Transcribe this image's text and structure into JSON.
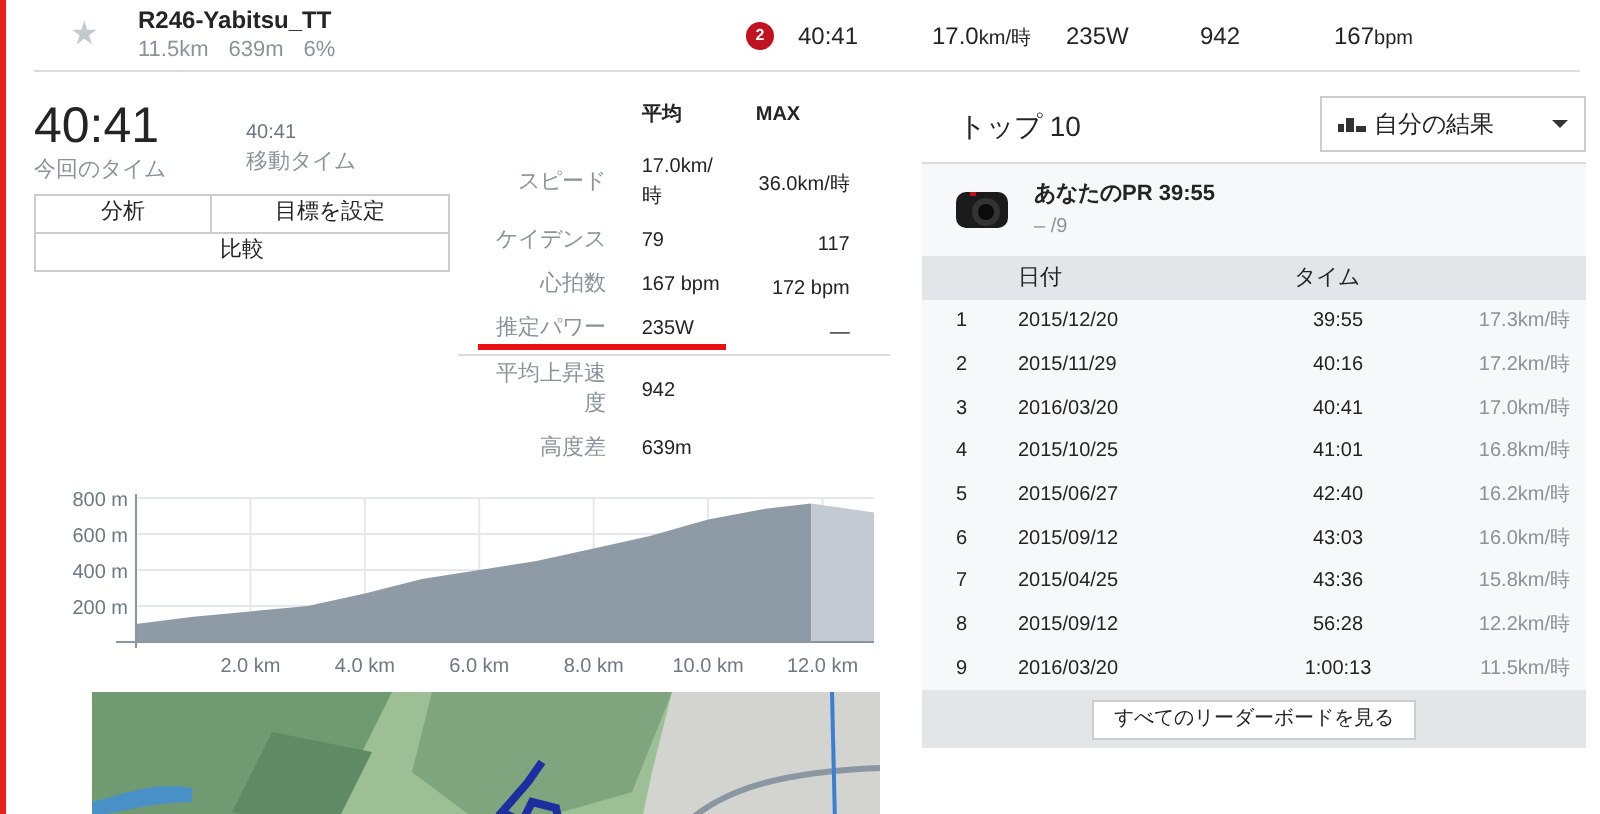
{
  "segment_row": {
    "star_icon": "★",
    "starred": false,
    "title": "R246-Yabitsu_TT",
    "stats": [
      "11.5km",
      "639m",
      "6%"
    ],
    "badge": "2",
    "time": "40:41",
    "speed": {
      "value": "17.0",
      "unit": "km/時"
    },
    "power": "235W",
    "climb": "942",
    "heart": {
      "value": "167",
      "unit": "bpm"
    }
  },
  "summary": {
    "time": "40:41",
    "time_label": "今回のタイム",
    "moving_time": "40:41",
    "moving_label": "移動タイム"
  },
  "buttons": [
    {
      "label": "分析"
    },
    {
      "label": "目標を設定"
    },
    {
      "label": "比較"
    }
  ],
  "stats_table": {
    "columns": [
      "平均",
      "MAX"
    ],
    "rows": [
      {
        "label": "スピード",
        "avg": "17.0km/時",
        "max": "36.0km/時"
      },
      {
        "label": "ケイデンス",
        "avg": "79",
        "max": "117"
      },
      {
        "label": "心拍数",
        "avg": "167 bpm",
        "max": "172 bpm"
      },
      {
        "label": "推定パワー",
        "avg": "235W",
        "max": "—",
        "underlined": true
      },
      {
        "label": "平均上昇速度",
        "avg": "942"
      },
      {
        "label": "高度差",
        "avg": "639m"
      }
    ]
  },
  "elevation": {
    "chart_data": {
      "type": "area",
      "grid": true,
      "x": [
        0,
        1,
        2,
        3,
        4,
        5,
        6,
        7,
        8,
        9,
        10,
        11,
        11.8,
        12.9
      ],
      "series": [
        {
          "color": "#8e9aa6",
          "values": [
            100,
            140,
            170,
            200,
            270,
            350,
            400,
            450,
            520,
            590,
            680,
            740,
            770,
            null
          ]
        },
        {
          "color": "#c3cad1",
          "values": [
            null,
            null,
            null,
            null,
            null,
            null,
            null,
            null,
            null,
            null,
            null,
            null,
            770,
            720
          ]
        }
      ],
      "xlim": [
        0,
        12.9
      ],
      "ylim": [
        0,
        800
      ],
      "xticks": [
        {
          "value": 2,
          "label": "2.0 km"
        },
        {
          "value": 4,
          "label": "4.0 km"
        },
        {
          "value": 6,
          "label": "6.0 km"
        },
        {
          "value": 8,
          "label": "8.0 km"
        },
        {
          "value": 10,
          "label": "10.0 km"
        },
        {
          "value": 12,
          "label": "12.0 km"
        }
      ],
      "yticks": [
        {
          "value": 200,
          "label": "200 m"
        },
        {
          "value": 400,
          "label": "400 m"
        },
        {
          "value": 600,
          "label": "600 m"
        },
        {
          "value": 800,
          "label": "800 m"
        }
      ]
    }
  },
  "leaderboard": {
    "title": "トップ 10",
    "filter": "自分の結果",
    "pr": {
      "title": "あなたのPR 39:55",
      "rank": "– /9"
    },
    "columns": [
      "日付",
      "タイム"
    ],
    "rows": [
      {
        "rank": "1",
        "date": "2015/12/20",
        "time": "39:55",
        "speed": "17.3km/時"
      },
      {
        "rank": "2",
        "date": "2015/11/29",
        "time": "40:16",
        "speed": "17.2km/時"
      },
      {
        "rank": "3",
        "date": "2016/03/20",
        "time": "40:41",
        "speed": "17.0km/時"
      },
      {
        "rank": "4",
        "date": "2015/10/25",
        "time": "41:01",
        "speed": "16.8km/時"
      },
      {
        "rank": "5",
        "date": "2015/06/27",
        "time": "42:40",
        "speed": "16.2km/時"
      },
      {
        "rank": "6",
        "date": "2015/09/12",
        "time": "43:03",
        "speed": "16.0km/時"
      },
      {
        "rank": "7",
        "date": "2015/04/25",
        "time": "43:36",
        "speed": "15.8km/時"
      },
      {
        "rank": "8",
        "date": "2015/09/12",
        "time": "56:28",
        "speed": "12.2km/時"
      },
      {
        "rank": "9",
        "date": "2016/03/20",
        "time": "1:00:13",
        "speed": "11.5km/時"
      }
    ],
    "view_all": "すべてのリーダーボードを見る"
  }
}
